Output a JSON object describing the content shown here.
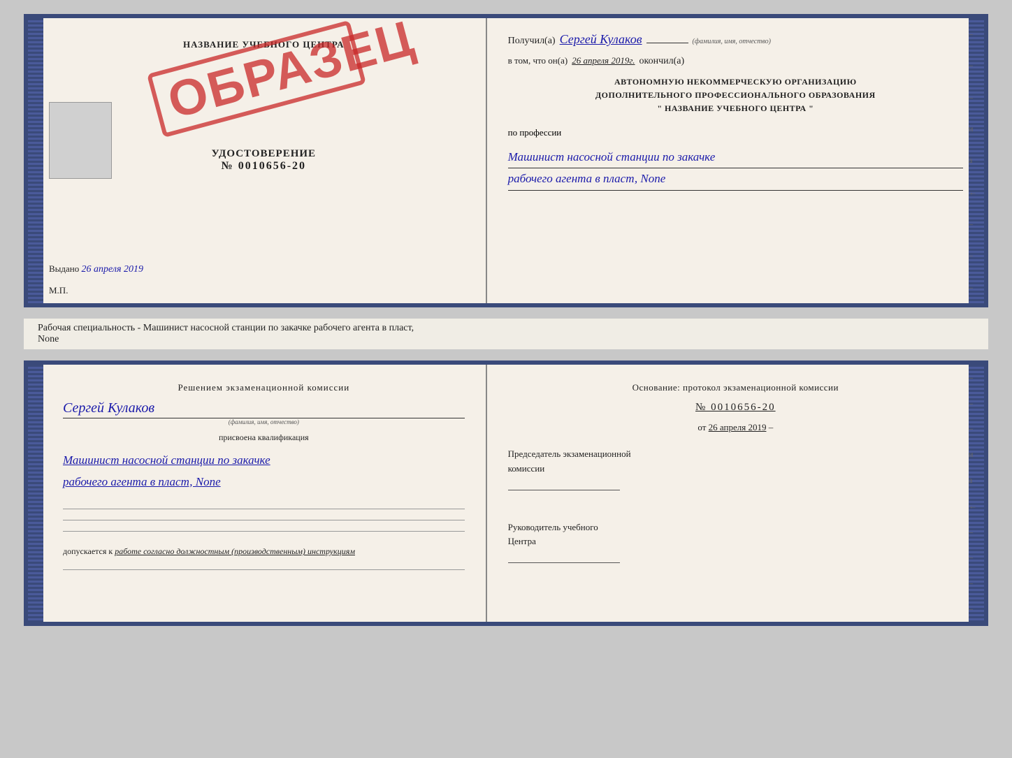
{
  "top_doc": {
    "left": {
      "title": "НАЗВАНИЕ УЧЕБНОГО ЦЕНТРА",
      "stamp": "ОБРАЗЕЦ",
      "udostoverenie_label": "УДОСТОВЕРЕНИЕ",
      "number": "№ 0010656-20",
      "vydano_label": "Выдано",
      "vydano_date": "26 апреля 2019",
      "mp_label": "М.П."
    },
    "right": {
      "poluchil_label": "Получил(а)",
      "poluchil_name": "Сергей Кулаков",
      "familiya_hint": "(фамилия, имя, отчество)",
      "vtom_label": "в том, что он(а)",
      "vtom_date": "26 апреля 2019г.",
      "okonchil_label": "окончил(а)",
      "avto_line1": "АВТОНОМНУЮ НЕКОММЕРЧЕСКУЮ ОРГАНИЗАЦИЮ",
      "avto_line2": "ДОПОЛНИТЕЛЬНОГО ПРОФЕССИОНАЛЬНОГО ОБРАЗОВАНИЯ",
      "avto_line3": "\"  НАЗВАНИЕ УЧЕБНОГО ЦЕНТРА  \"",
      "po_professii_label": "по профессии",
      "profession_line1": "Машинист насосной станции по закачке",
      "profession_line2": "рабочего агента в пласт, None"
    }
  },
  "subtitle": "Рабочая специальность - Машинист насосной станции по закачке рабочего агента в пласт,",
  "subtitle2": "None",
  "bottom_doc": {
    "left": {
      "komissia_text": "Решением экзаменационной комиссии",
      "person_name": "Сергей Кулаков",
      "familiya_hint": "(фамилия, имя, отчество)",
      "prisvоena_label": "присвоена квалификация",
      "qual_line1": "Машинист насосной станции по закачке",
      "qual_line2": "рабочего агента в пласт, None",
      "dopuskaetsya_label": "допускается к",
      "dopuskaetsya_value": "работе согласно должностным (производственным) инструкциям"
    },
    "right": {
      "osnov_label": "Основание: протокол экзаменационной комиссии",
      "protocol_number": "№ 0010656-20",
      "ot_label": "от",
      "ot_date": "26 апреля 2019",
      "predsedatel_label": "Председатель экзаменационной",
      "komissii_label": "комиссии",
      "rukovoditel_label": "Руководитель учебного",
      "tsentra_label": "Центра"
    }
  },
  "dashes": [
    "-",
    "-",
    "-",
    "и",
    "а",
    "←",
    "-",
    "-",
    "-"
  ],
  "dashes_bottom": [
    "-",
    "-",
    "-",
    "и",
    "а",
    "←",
    "-",
    "-",
    "-",
    "-"
  ]
}
